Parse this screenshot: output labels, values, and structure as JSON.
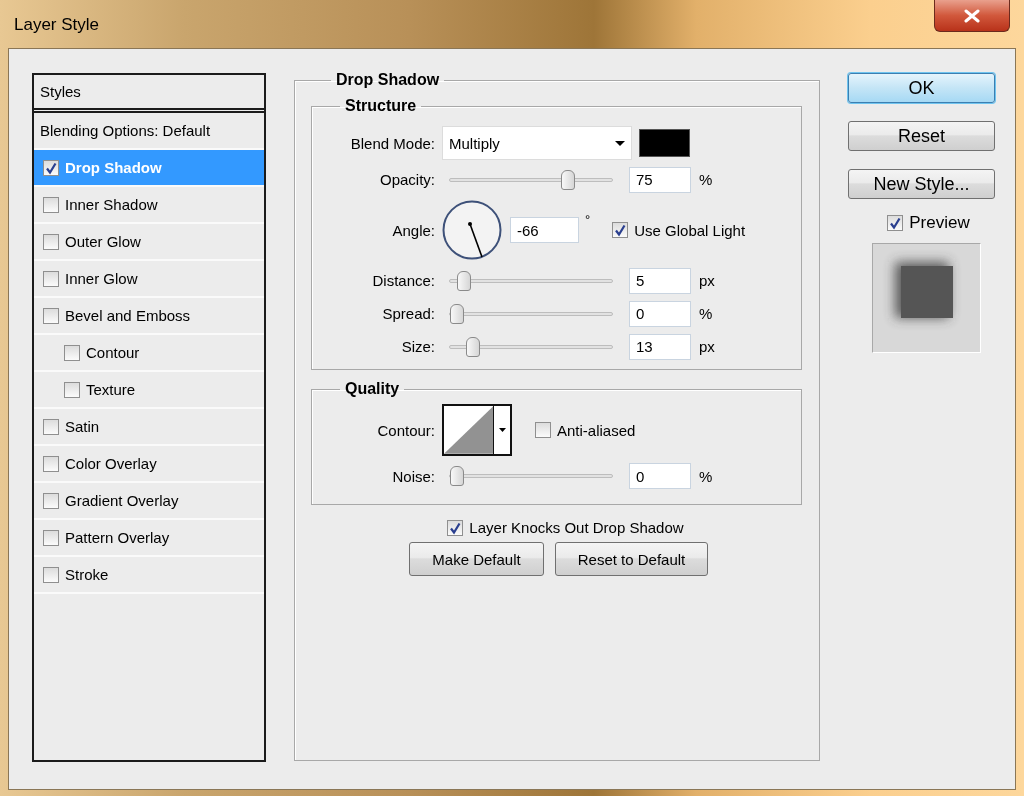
{
  "window": {
    "title": "Layer Style"
  },
  "sidebar": {
    "header": "Styles",
    "items": [
      {
        "label": "Blending Options: Default",
        "kind": "plain",
        "selected": false
      },
      {
        "label": "Drop Shadow",
        "kind": "check",
        "checked": true,
        "selected": true
      },
      {
        "label": "Inner Shadow",
        "kind": "check",
        "checked": false,
        "selected": false
      },
      {
        "label": "Outer Glow",
        "kind": "check",
        "checked": false,
        "selected": false
      },
      {
        "label": "Inner Glow",
        "kind": "check",
        "checked": false,
        "selected": false
      },
      {
        "label": "Bevel and Emboss",
        "kind": "check",
        "checked": false,
        "selected": false,
        "children": [
          {
            "label": "Contour",
            "kind": "check",
            "checked": false,
            "selected": false
          },
          {
            "label": "Texture",
            "kind": "check",
            "checked": false,
            "selected": false
          }
        ]
      },
      {
        "label": "Satin",
        "kind": "check",
        "checked": false,
        "selected": false
      },
      {
        "label": "Color Overlay",
        "kind": "check",
        "checked": false,
        "selected": false
      },
      {
        "label": "Gradient Overlay",
        "kind": "check",
        "checked": false,
        "selected": false
      },
      {
        "label": "Pattern Overlay",
        "kind": "check",
        "checked": false,
        "selected": false
      },
      {
        "label": "Stroke",
        "kind": "check",
        "checked": false,
        "selected": false
      }
    ]
  },
  "panel": {
    "title": "Drop Shadow",
    "structure": {
      "title": "Structure",
      "blend_mode": {
        "label": "Blend Mode:",
        "value": "Multiply"
      },
      "color": "#000000",
      "rows": [
        {
          "kind": "slider",
          "label": "Opacity:",
          "level": 0.75,
          "value": "75",
          "unit": "%"
        },
        {
          "kind": "angle",
          "label": "Angle:",
          "value": "-66",
          "unit": "°",
          "global_light": {
            "label": "Use Global Light",
            "checked": true
          }
        },
        {
          "kind": "slider",
          "label": "Distance:",
          "level": 0.05,
          "value": "5",
          "unit": "px"
        },
        {
          "kind": "slider",
          "label": "Spread:",
          "level": 0,
          "value": "0",
          "unit": "%"
        },
        {
          "kind": "slider",
          "label": "Size:",
          "level": 0.11,
          "value": "13",
          "unit": "px"
        }
      ]
    },
    "quality": {
      "title": "Quality",
      "contour": {
        "label": "Contour:"
      },
      "anti_aliased": {
        "label": "Anti-aliased",
        "checked": false
      },
      "noise": {
        "label": "Noise:",
        "level": 0,
        "value": "0",
        "unit": "%"
      }
    },
    "knockout": {
      "label": "Layer Knocks Out Drop Shadow",
      "checked": true
    },
    "buttons": [
      "Make Default",
      "Reset to Default"
    ]
  },
  "actions": {
    "buttons": [
      {
        "label": "OK",
        "default": true
      },
      {
        "label": "Reset",
        "default": false
      },
      {
        "label": "New Style...",
        "default": false
      }
    ],
    "preview": {
      "label": "Preview",
      "checked": true
    }
  }
}
